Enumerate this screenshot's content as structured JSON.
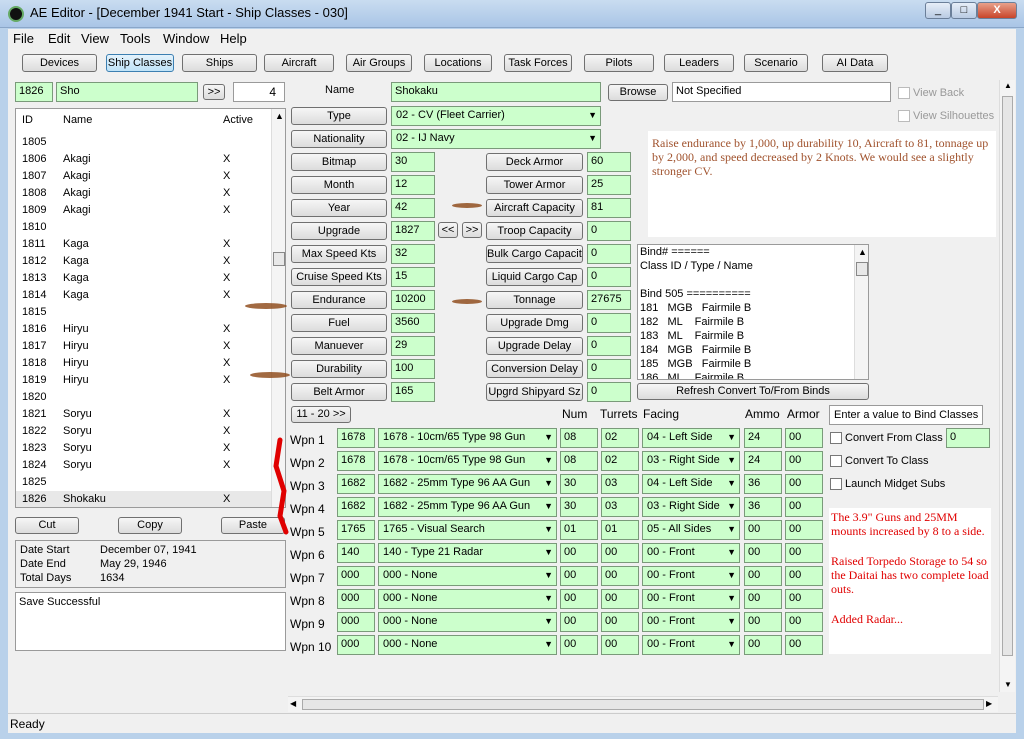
{
  "window": {
    "title": "AE Editor - [December 1941 Start - Ship Classes - 030]",
    "min": "_",
    "max": "□",
    "close": "X"
  },
  "menu": [
    "File",
    "Edit",
    "View",
    "Tools",
    "Window",
    "Help"
  ],
  "tabs": [
    "Devices",
    "Ship Classes",
    "Ships",
    "Aircraft",
    "Air Groups",
    "Locations",
    "Task Forces",
    "Pilots",
    "Leaders",
    "Scenario",
    "AI Data"
  ],
  "search": {
    "id": "1826",
    "name": "Sho",
    "go": ">>",
    "count": "4"
  },
  "list": {
    "headers": {
      "id": "ID",
      "name": "Name",
      "active": "Active"
    },
    "rows": [
      {
        "id": "1805",
        "name": "",
        "active": ""
      },
      {
        "id": "1806",
        "name": "Akagi",
        "active": "X"
      },
      {
        "id": "1807",
        "name": "Akagi",
        "active": "X"
      },
      {
        "id": "1808",
        "name": "Akagi",
        "active": "X"
      },
      {
        "id": "1809",
        "name": "Akagi",
        "active": "X"
      },
      {
        "id": "1810",
        "name": "",
        "active": ""
      },
      {
        "id": "1811",
        "name": "Kaga",
        "active": "X"
      },
      {
        "id": "1812",
        "name": "Kaga",
        "active": "X"
      },
      {
        "id": "1813",
        "name": "Kaga",
        "active": "X"
      },
      {
        "id": "1814",
        "name": "Kaga",
        "active": "X"
      },
      {
        "id": "1815",
        "name": "",
        "active": ""
      },
      {
        "id": "1816",
        "name": "Hiryu",
        "active": "X"
      },
      {
        "id": "1817",
        "name": "Hiryu",
        "active": "X"
      },
      {
        "id": "1818",
        "name": "Hiryu",
        "active": "X"
      },
      {
        "id": "1819",
        "name": "Hiryu",
        "active": "X"
      },
      {
        "id": "1820",
        "name": "",
        "active": ""
      },
      {
        "id": "1821",
        "name": "Soryu",
        "active": "X"
      },
      {
        "id": "1822",
        "name": "Soryu",
        "active": "X"
      },
      {
        "id": "1823",
        "name": "Soryu",
        "active": "X"
      },
      {
        "id": "1824",
        "name": "Soryu",
        "active": "X"
      },
      {
        "id": "1825",
        "name": "",
        "active": ""
      },
      {
        "id": "1826",
        "name": "Shokaku",
        "active": "X"
      }
    ]
  },
  "actions": {
    "cut": "Cut",
    "copy": "Copy",
    "paste": "Paste"
  },
  "dates": {
    "start_label": "Date Start",
    "start": "December 07, 1941",
    "end_label": "Date End",
    "end": "May 29, 1946",
    "days_label": "Total Days",
    "days": "1634"
  },
  "status_box": "Save Successful",
  "form": {
    "name_label": "Name",
    "name": "Shokaku",
    "browse": "Browse",
    "not_specified": "Not Specified",
    "view_back": "View Back",
    "view_silhouettes": "View Silhouettes",
    "type_label": "Type",
    "type": "02 - CV (Fleet Carrier)",
    "nationality_label": "Nationality",
    "nationality": "02 - IJ Navy",
    "left": [
      {
        "label": "Bitmap",
        "value": "30"
      },
      {
        "label": "Month",
        "value": "12"
      },
      {
        "label": "Year",
        "value": "42"
      },
      {
        "label": "Upgrade",
        "value": "1827"
      },
      {
        "label": "Max Speed Kts",
        "value": "32"
      },
      {
        "label": "Cruise Speed Kts",
        "value": "15"
      },
      {
        "label": "Endurance",
        "value": "10200"
      },
      {
        "label": "Fuel",
        "value": "3560"
      },
      {
        "label": "Manuever",
        "value": "29"
      },
      {
        "label": "Durability",
        "value": "100"
      },
      {
        "label": "Belt Armor",
        "value": "165"
      }
    ],
    "right": [
      {
        "label": "Deck Armor",
        "value": "60"
      },
      {
        "label": "Tower Armor",
        "value": "25"
      },
      {
        "label": "Aircraft Capacity",
        "value": "81"
      },
      {
        "label": "Troop Capacity",
        "value": "0"
      },
      {
        "label": "Bulk Cargo Capacity",
        "value": "0"
      },
      {
        "label": "Liquid Cargo Cap",
        "value": "0"
      },
      {
        "label": "Tonnage",
        "value": "27675"
      },
      {
        "label": "Upgrade Dmg",
        "value": "0"
      },
      {
        "label": "Upgrade Delay",
        "value": "0"
      },
      {
        "label": "Conversion Delay",
        "value": "0"
      },
      {
        "label": "Upgrd Shipyard Sz",
        "value": "0"
      }
    ],
    "prev": "<<",
    "next": ">>"
  },
  "annotation_top": "Raise endurance by 1,000, up durability 10, Aircraft to 81, tonnage up by 2,000, and speed decreased by 2 Knots.  We would see a slightly stronger CV.",
  "binds": {
    "lines": [
      "Bind# ======",
      "Class ID / Type / Name",
      "",
      "Bind 505 ==========",
      "181   MGB   Fairmile B",
      "182   ML    Fairmile B",
      "183   ML    Fairmile B",
      "184   MGB   Fairmile B",
      "185   MGB   Fairmile B",
      "186   ML    Fairmile B"
    ],
    "refresh": "Refresh Convert To/From Binds"
  },
  "weapons": {
    "page": "11 - 20 >>",
    "headers": {
      "num": "Num",
      "turrets": "Turrets",
      "facing": "Facing",
      "ammo": "Ammo",
      "armor": "Armor"
    },
    "rows": [
      {
        "label": "Wpn 1",
        "id": "1678",
        "device": "1678 - 10cm/65 Type 98 Gun",
        "num": "08",
        "turrets": "02",
        "facing": "04 - Left Side",
        "ammo": "24",
        "armor": "00"
      },
      {
        "label": "Wpn 2",
        "id": "1678",
        "device": "1678 - 10cm/65 Type 98 Gun",
        "num": "08",
        "turrets": "02",
        "facing": "03 - Right Side",
        "ammo": "24",
        "armor": "00"
      },
      {
        "label": "Wpn 3",
        "id": "1682",
        "device": "1682 - 25mm Type 96 AA Gun",
        "num": "30",
        "turrets": "03",
        "facing": "04 - Left Side",
        "ammo": "36",
        "armor": "00"
      },
      {
        "label": "Wpn 4",
        "id": "1682",
        "device": "1682 - 25mm Type 96 AA Gun",
        "num": "30",
        "turrets": "03",
        "facing": "03 - Right Side",
        "ammo": "36",
        "armor": "00"
      },
      {
        "label": "Wpn 5",
        "id": "1765",
        "device": "1765 - Visual Search",
        "num": "01",
        "turrets": "01",
        "facing": "05 - All Sides",
        "ammo": "00",
        "armor": "00"
      },
      {
        "label": "Wpn 6",
        "id": "140",
        "device": "140 - Type 21 Radar",
        "num": "00",
        "turrets": "00",
        "facing": "00 - Front",
        "ammo": "00",
        "armor": "00"
      },
      {
        "label": "Wpn 7",
        "id": "000",
        "device": "000 - None",
        "num": "00",
        "turrets": "00",
        "facing": "00 - Front",
        "ammo": "00",
        "armor": "00"
      },
      {
        "label": "Wpn 8",
        "id": "000",
        "device": "000 - None",
        "num": "00",
        "turrets": "00",
        "facing": "00 - Front",
        "ammo": "00",
        "armor": "00"
      },
      {
        "label": "Wpn 9",
        "id": "000",
        "device": "000 - None",
        "num": "00",
        "turrets": "00",
        "facing": "00 - Front",
        "ammo": "00",
        "armor": "00"
      },
      {
        "label": "Wpn 10",
        "id": "000",
        "device": "000 - None",
        "num": "00",
        "turrets": "00",
        "facing": "00 - Front",
        "ammo": "00",
        "armor": "00"
      }
    ]
  },
  "bind_panel": {
    "title": "Enter a value to Bind Classes",
    "convert_from": "Convert From Class",
    "convert_from_value": "0",
    "convert_to": "Convert To Class",
    "launch_midget": "Launch Midget Subs"
  },
  "annotation_bottom": [
    "The 3.9\" Guns and 25MM mounts increased by 8 to a side.",
    "Raised Torpedo Storage to 54 so the Daitai has two complete load outs.",
    "Added Radar..."
  ],
  "status": "Ready",
  "colors": {
    "field": "#ccffcc",
    "annotation_top": "#a0522d",
    "annotation_bottom": "#e00000",
    "marker_brown": "#8b4513",
    "marker_red": "#e00000"
  }
}
